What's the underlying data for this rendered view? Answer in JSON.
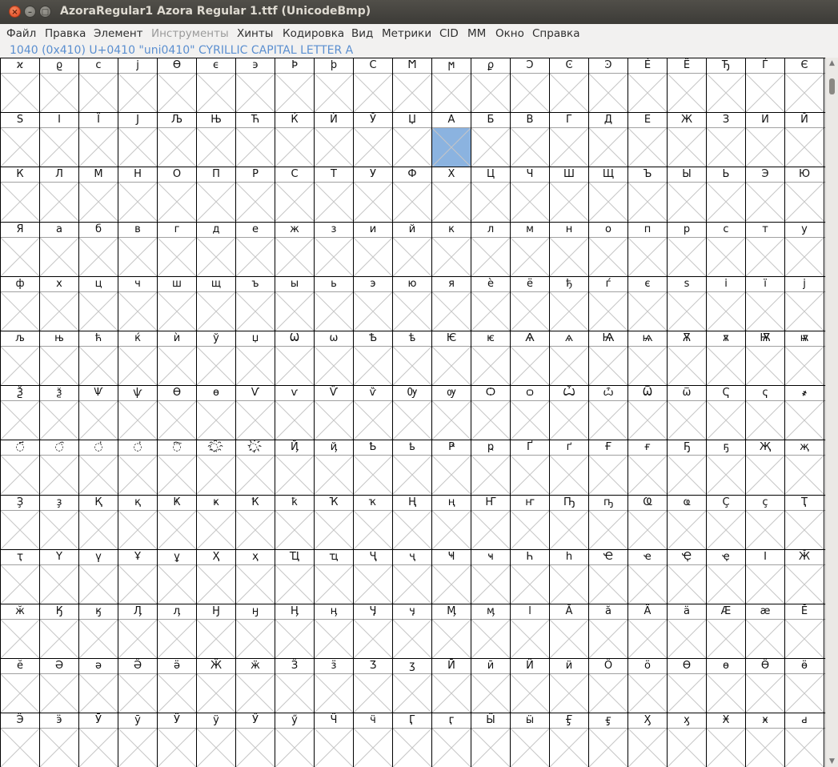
{
  "window": {
    "title": "AzoraRegular1  Azora Regular 1.ttf (UnicodeBmp)",
    "controls": {
      "close": "×",
      "minimize": "–",
      "maximize": "□"
    }
  },
  "menu": [
    {
      "label": "Файл",
      "enabled": true
    },
    {
      "label": "Правка",
      "enabled": true
    },
    {
      "label": "Элемент",
      "enabled": true
    },
    {
      "label": "Инструменты",
      "enabled": false
    },
    {
      "label": "Хинты",
      "enabled": true
    },
    {
      "label": "Кодировка",
      "enabled": true
    },
    {
      "label": "Вид",
      "enabled": true
    },
    {
      "label": "Метрики",
      "enabled": true
    },
    {
      "label": "CID",
      "enabled": true
    },
    {
      "label": "MM",
      "enabled": true
    },
    {
      "label": "Окно",
      "enabled": true
    },
    {
      "label": "Справка",
      "enabled": true
    }
  ],
  "glyph_info": "1040 (0x410) U+0410 \"uni0410\" CYRILLIC CAPITAL LETTER A",
  "selected_glyph": "uni0410",
  "colors": {
    "selection": "#8bb3e0",
    "info_text": "#5b8fd0"
  },
  "scrollbar": {
    "up_icon": "▲",
    "down_icon": "▼"
  },
  "grid": {
    "columns": 21,
    "rows": [
      [
        "ϰ",
        "ϱ",
        "ϲ",
        "ϳ",
        "ϴ",
        "ϵ",
        "϶",
        "Ϸ",
        "ϸ",
        "Ϲ",
        "Ϻ",
        "ϻ",
        "ϼ",
        "Ͻ",
        "Ͼ",
        "Ͽ",
        "Ѐ",
        "Ё",
        "Ђ",
        "Ѓ",
        "Є"
      ],
      [
        "Ѕ",
        "І",
        "Ї",
        "Ј",
        "Љ",
        "Њ",
        "Ћ",
        "Ќ",
        "Ѝ",
        "Ў",
        "Џ",
        "А",
        "Б",
        "В",
        "Г",
        "Д",
        "Е",
        "Ж",
        "З",
        "И",
        "Й"
      ],
      [
        "К",
        "Л",
        "М",
        "Н",
        "О",
        "П",
        "Р",
        "С",
        "Т",
        "У",
        "Ф",
        "Х",
        "Ц",
        "Ч",
        "Ш",
        "Щ",
        "Ъ",
        "Ы",
        "Ь",
        "Э",
        "Ю"
      ],
      [
        "Я",
        "а",
        "б",
        "в",
        "г",
        "д",
        "е",
        "ж",
        "з",
        "и",
        "й",
        "к",
        "л",
        "м",
        "н",
        "о",
        "п",
        "р",
        "с",
        "т",
        "у"
      ],
      [
        "ф",
        "х",
        "ц",
        "ч",
        "ш",
        "щ",
        "ъ",
        "ы",
        "ь",
        "э",
        "ю",
        "я",
        "ѐ",
        "ё",
        "ђ",
        "ѓ",
        "є",
        "ѕ",
        "і",
        "ї",
        "ј"
      ],
      [
        "љ",
        "њ",
        "ћ",
        "ќ",
        "ѝ",
        "ў",
        "џ",
        "Ѡ",
        "ѡ",
        "Ѣ",
        "ѣ",
        "Ѥ",
        "ѥ",
        "Ѧ",
        "ѧ",
        "Ѩ",
        "ѩ",
        "Ѫ",
        "ѫ",
        "Ѭ",
        "ѭ"
      ],
      [
        "Ѯ",
        "ѯ",
        "Ѱ",
        "ѱ",
        "Ѳ",
        "ѳ",
        "Ѵ",
        "ѵ",
        "Ѷ",
        "ѷ",
        "Ѹ",
        "ѹ",
        "Ѻ",
        "ѻ",
        "Ѽ",
        "ѽ",
        "Ѿ",
        "ѿ",
        "Ҁ",
        "ҁ",
        "҂"
      ],
      [
        "◌҃",
        "◌҄",
        "◌҅",
        "◌҆",
        "◌҇",
        "◌҈",
        "◌҉",
        "Ҋ",
        "ҋ",
        "Ҍ",
        "ҍ",
        "Ҏ",
        "ҏ",
        "Ґ",
        "ґ",
        "Ғ",
        "ғ",
        "Ҕ",
        "ҕ",
        "Җ",
        "җ"
      ],
      [
        "Ҙ",
        "ҙ",
        "Қ",
        "қ",
        "Ҝ",
        "ҝ",
        "Ҟ",
        "ҟ",
        "Ҡ",
        "ҡ",
        "Ң",
        "ң",
        "Ҥ",
        "ҥ",
        "Ҧ",
        "ҧ",
        "Ҩ",
        "ҩ",
        "Ҫ",
        "ҫ",
        "Ҭ"
      ],
      [
        "ҭ",
        "Ү",
        "ү",
        "Ұ",
        "ұ",
        "Ҳ",
        "ҳ",
        "Ҵ",
        "ҵ",
        "Ҷ",
        "ҷ",
        "Ҹ",
        "ҹ",
        "Һ",
        "һ",
        "Ҽ",
        "ҽ",
        "Ҿ",
        "ҿ",
        "Ӏ",
        "Ӂ"
      ],
      [
        "ӂ",
        "Ӄ",
        "ӄ",
        "Ӆ",
        "ӆ",
        "Ӈ",
        "ӈ",
        "Ӊ",
        "ӊ",
        "Ӌ",
        "ӌ",
        "Ӎ",
        "ӎ",
        "ӏ",
        "Ӑ",
        "ӑ",
        "Ӓ",
        "ӓ",
        "Ӕ",
        "ӕ",
        "Ӗ"
      ],
      [
        "ӗ",
        "Ә",
        "ә",
        "Ӛ",
        "ӛ",
        "Ӝ",
        "ӝ",
        "Ӟ",
        "ӟ",
        "Ӡ",
        "ӡ",
        "Ӣ",
        "ӣ",
        "Ӥ",
        "ӥ",
        "Ӧ",
        "ӧ",
        "Ө",
        "ө",
        "Ӫ",
        "ӫ"
      ],
      [
        "Ӭ",
        "ӭ",
        "Ӯ",
        "ӯ",
        "Ӱ",
        "ӱ",
        "Ӳ",
        "ӳ",
        "Ӵ",
        "ӵ",
        "Ӷ",
        "ӷ",
        "Ӹ",
        "ӹ",
        "Ӻ",
        "ӻ",
        "Ӽ",
        "ӽ",
        "Ӿ",
        "ӿ",
        "ԁ"
      ]
    ]
  }
}
